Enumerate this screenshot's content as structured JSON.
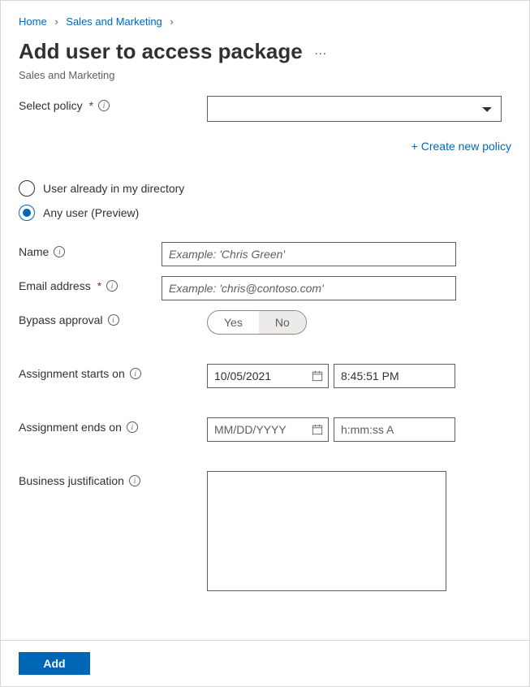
{
  "breadcrumb": {
    "home": "Home",
    "section": "Sales and Marketing"
  },
  "title": "Add user to access package",
  "subtitle": "Sales and Marketing",
  "policy": {
    "label": "Select policy",
    "value": "",
    "createNew": "+ Create new policy"
  },
  "userType": {
    "options": [
      {
        "label": "User already in my directory",
        "checked": false
      },
      {
        "label": "Any user (Preview)",
        "checked": true
      }
    ]
  },
  "name": {
    "label": "Name",
    "placeholder": "Example: 'Chris Green'",
    "value": ""
  },
  "email": {
    "label": "Email address",
    "placeholder": "Example: 'chris@contoso.com'",
    "value": ""
  },
  "bypass": {
    "label": "Bypass approval",
    "yes": "Yes",
    "no": "No",
    "selected": "no"
  },
  "start": {
    "label": "Assignment starts on",
    "date": "10/05/2021",
    "time": "8:45:51 PM"
  },
  "end": {
    "label": "Assignment ends on",
    "datePlaceholder": "MM/DD/YYYY",
    "dateValue": "",
    "timePlaceholder": "h:mm:ss A",
    "timeValue": ""
  },
  "justification": {
    "label": "Business justification",
    "value": ""
  },
  "footer": {
    "add": "Add"
  }
}
